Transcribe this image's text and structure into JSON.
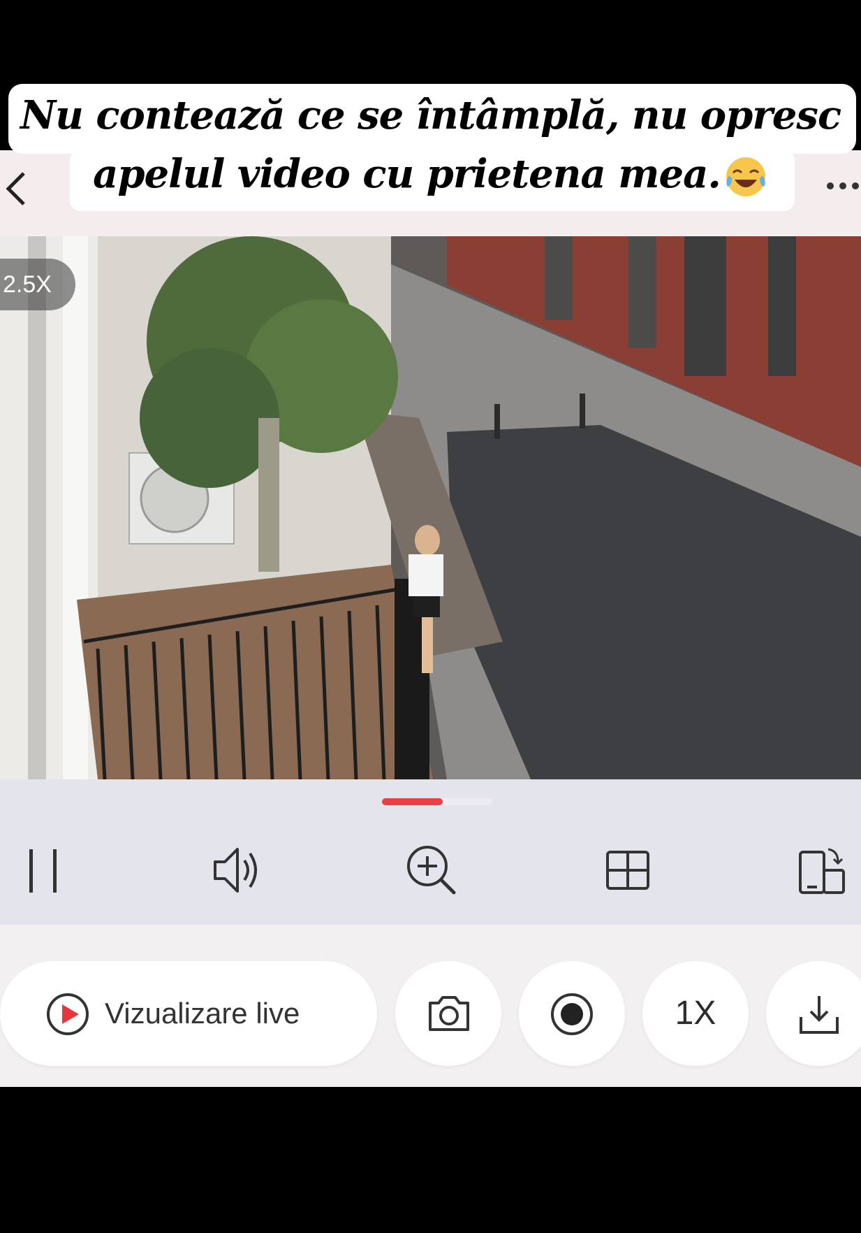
{
  "caption": {
    "line1": "Nu contează ce se întâmplă, nu opresc",
    "line2": "apelul video cu prietena mea.",
    "emoji": "laughing-tears-emoji"
  },
  "header": {
    "back_icon": "chevron-left-icon",
    "more_icon": "ellipsis-icon"
  },
  "video": {
    "zoom_label": "2.5X",
    "scene": "security-camera-feed"
  },
  "playback": {
    "progress": 0.55,
    "accent_color": "#ea3f43",
    "controls": [
      {
        "name": "pause-icon"
      },
      {
        "name": "volume-icon"
      },
      {
        "name": "zoom-in-icon"
      },
      {
        "name": "grid-icon"
      },
      {
        "name": "rotate-screen-icon"
      }
    ]
  },
  "actions": {
    "live_label": "Vizualizare live",
    "live_icon": "play-circle-icon",
    "snapshot_icon": "camera-icon",
    "record_icon": "record-icon",
    "speed_label": "1X",
    "download_icon": "download-icon"
  }
}
